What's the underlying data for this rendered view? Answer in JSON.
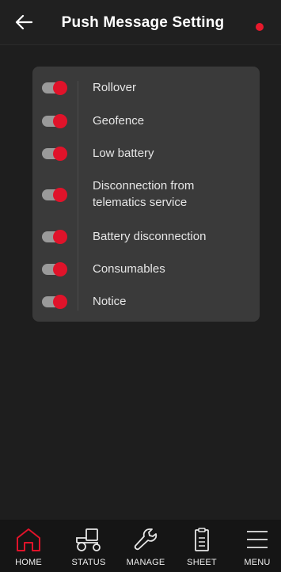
{
  "header": {
    "title": "Push Message Setting",
    "back_icon": "arrow-left-icon",
    "status_dot_color": "#e8192c"
  },
  "settings": {
    "items": [
      {
        "label": "Rollover",
        "enabled": true
      },
      {
        "label": "Geofence",
        "enabled": true
      },
      {
        "label": "Low battery",
        "enabled": true
      },
      {
        "label": "Disconnection from telematics service",
        "enabled": true
      },
      {
        "label": "Battery disconnection",
        "enabled": true
      },
      {
        "label": "Consumables",
        "enabled": true
      },
      {
        "label": "Notice",
        "enabled": true
      }
    ]
  },
  "bottom_nav": {
    "items": [
      {
        "label": "HOME",
        "icon": "home-icon",
        "active": true
      },
      {
        "label": "STATUS",
        "icon": "tractor-icon",
        "active": false
      },
      {
        "label": "MANAGE",
        "icon": "wrench-icon",
        "active": false
      },
      {
        "label": "SHEET",
        "icon": "clipboard-icon",
        "active": false
      },
      {
        "label": "MENU",
        "icon": "hamburger-menu-icon",
        "active": false
      }
    ]
  },
  "colors": {
    "accent": "#e0132a",
    "toggle_track": "#9a9a9a",
    "card_background": "#3a3a3a",
    "page_background": "#1e1e1e"
  }
}
